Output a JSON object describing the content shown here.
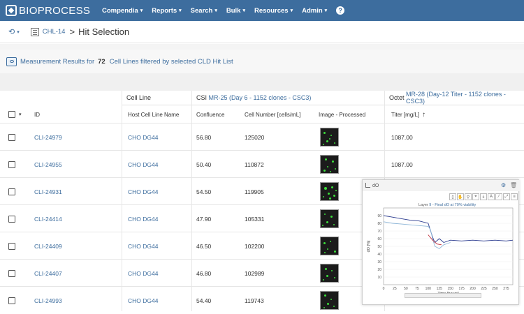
{
  "nav": {
    "brand": "BIOPROCESS",
    "menu": [
      {
        "label": "Compendia"
      },
      {
        "label": "Reports"
      },
      {
        "label": "Search"
      },
      {
        "label": "Bulk"
      },
      {
        "label": "Resources"
      },
      {
        "label": "Admin"
      }
    ],
    "help": "?"
  },
  "breadcrumb": {
    "project": "CHL-14",
    "separator": ">",
    "title": "Hit Selection"
  },
  "results": {
    "prefix": "Measurement Results for",
    "count": "72",
    "suffix": "Cell Lines filtered by selected CLD Hit List"
  },
  "groups": {
    "cell_line": "Cell Line",
    "csi_prefix": "CSI",
    "csi_link": "MR-25 (Day 6 - 1152 clones - CSC3)",
    "octet_prefix": "Octet",
    "octet_link": "MR-28 (Day-12 Titer - 1152 clones - CSC3)"
  },
  "columns": {
    "id": "ID",
    "host": "Host Cell Line Name",
    "confluence": "Confluence",
    "cell_number": "Cell Number [cells/mL]",
    "image": "Image - Processed",
    "titer": "Titer [mg/L]",
    "sort_arrow": "↑"
  },
  "rows": [
    {
      "id": "CLI-24979",
      "host": "CHO DG44",
      "confluence": "56.80",
      "cell_number": "125020",
      "titer": "1087.00"
    },
    {
      "id": "CLI-24955",
      "host": "CHO DG44",
      "confluence": "50.40",
      "cell_number": "110872",
      "titer": "1087.00"
    },
    {
      "id": "CLI-24931",
      "host": "CHO DG44",
      "confluence": "54.50",
      "cell_number": "119905",
      "titer": ""
    },
    {
      "id": "CLI-24414",
      "host": "CHO DG44",
      "confluence": "47.90",
      "cell_number": "105331",
      "titer": ""
    },
    {
      "id": "CLI-24409",
      "host": "CHO DG44",
      "confluence": "46.50",
      "cell_number": "102200",
      "titer": ""
    },
    {
      "id": "CLI-24407",
      "host": "CHO DG44",
      "confluence": "46.80",
      "cell_number": "102989",
      "titer": ""
    },
    {
      "id": "CLI-24993",
      "host": "CHO DG44",
      "confluence": "54.40",
      "cell_number": "119743",
      "titer": ""
    }
  ],
  "popup": {
    "label": "dO",
    "chart_title_prefix": "Layer",
    "chart_title_link": "9 - Final dO at 70% viability",
    "chart_data": {
      "type": "line",
      "xlabel": "Time [hours]",
      "ylabel": "dO [%]",
      "xlim": [
        0,
        290
      ],
      "ylim": [
        0,
        100
      ],
      "x_ticks": [
        "0",
        "25",
        "50",
        "75",
        "100",
        "125",
        "150",
        "175",
        "200",
        "225",
        "250",
        "275"
      ],
      "y_ticks": [
        "10",
        "20",
        "30",
        "40",
        "50",
        "60",
        "70",
        "80",
        "90"
      ],
      "series": [
        {
          "color": "#2b3b8f",
          "x": [
            0,
            20,
            40,
            60,
            80,
            100,
            110,
            115,
            125,
            135,
            150,
            175,
            200,
            225,
            250,
            275,
            290
          ],
          "values": [
            90,
            88,
            86,
            84,
            83,
            80,
            62,
            55,
            60,
            55,
            58,
            57,
            58,
            57,
            58,
            57,
            58
          ]
        },
        {
          "color": "#8fb7d8",
          "x": [
            0,
            20,
            40,
            60,
            80,
            100,
            105,
            110,
            115,
            125,
            135,
            150
          ],
          "values": [
            82,
            80,
            79,
            78,
            77,
            76,
            72,
            60,
            50,
            47,
            52,
            55
          ]
        },
        {
          "color": "#c0303c",
          "x": [
            100,
            110,
            120,
            130
          ],
          "values": [
            65,
            58,
            53,
            52
          ]
        }
      ]
    }
  }
}
